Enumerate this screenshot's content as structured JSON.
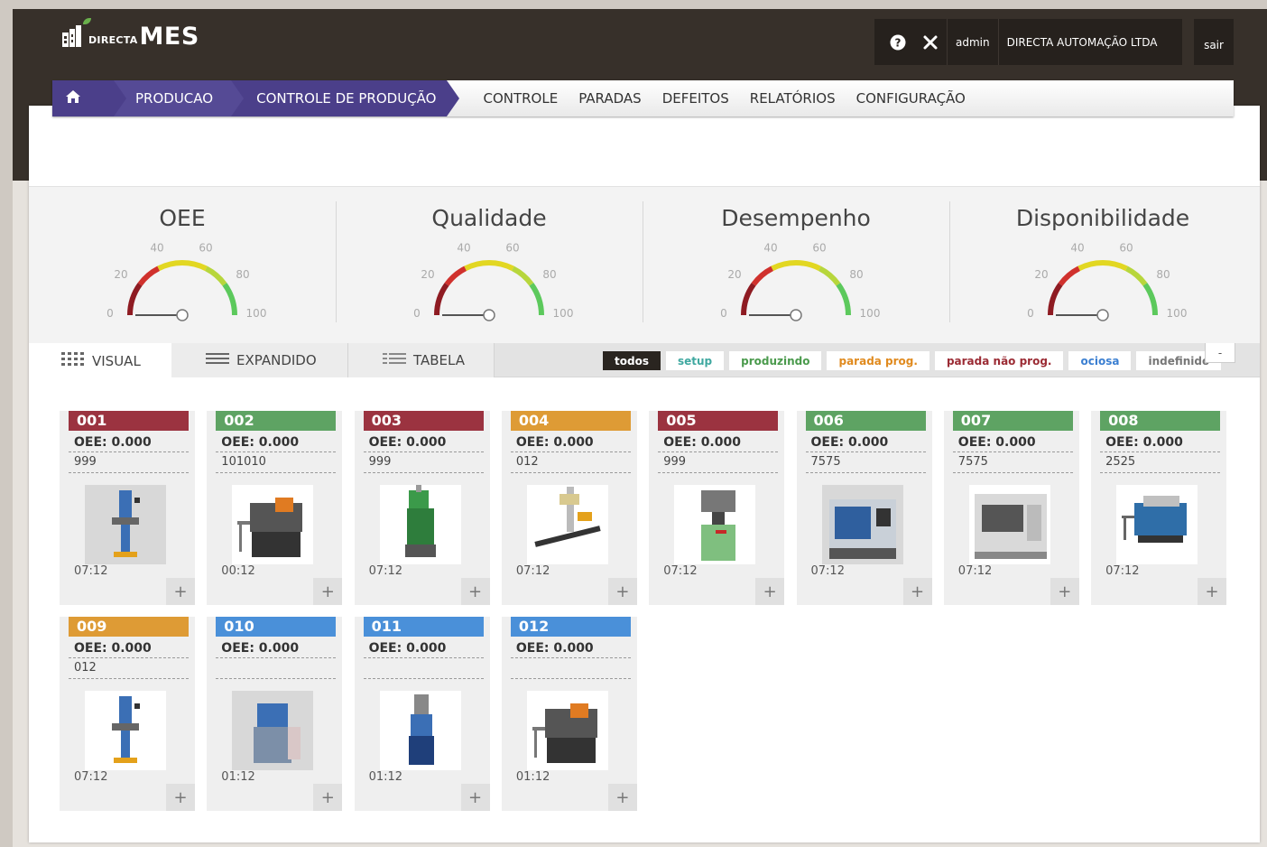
{
  "app": {
    "logo_small": "DIRECTA",
    "logo_big": "MES",
    "topbar": {
      "user": "admin",
      "company": "DIRECTA AUTOMAÇÃO LTDA",
      "logout": "sair"
    }
  },
  "nav": {
    "breadcrumbs": [
      "PRODUCAO",
      "CONTROLE DE PRODUÇÃO"
    ],
    "menu": [
      "CONTROLE",
      "PARADAS",
      "DEFEITOS",
      "RELATÓRIOS",
      "CONFIGURAÇÃO"
    ]
  },
  "gauges": [
    {
      "title": "OEE",
      "value": 0
    },
    {
      "title": "Qualidade",
      "value": 0
    },
    {
      "title": "Desempenho",
      "value": 0
    },
    {
      "title": "Disponibilidade",
      "value": 0
    }
  ],
  "gauge_ticks": [
    "0",
    "20",
    "40",
    "60",
    "80",
    "100"
  ],
  "views": [
    "VISUAL",
    "EXPANDIDO",
    "TABELA"
  ],
  "filters": [
    {
      "label": "todos",
      "color": "#ffffff",
      "active": true
    },
    {
      "label": "setup",
      "color": "#3fa8a0"
    },
    {
      "label": "produzindo",
      "color": "#4a9a4c"
    },
    {
      "label": "parada prog.",
      "color": "#e08a1e"
    },
    {
      "label": "parada não prog.",
      "color": "#9b2b34"
    },
    {
      "label": "ociosa",
      "color": "#3b7fd1"
    },
    {
      "label": "indefinido",
      "color": "#777777"
    }
  ],
  "collapse_label": "-",
  "status_colors": {
    "parada_nao_prog": "#9b3340",
    "produzindo": "#5ea363",
    "parada_prog": "#de9b35",
    "ociosa": "#4a90d9"
  },
  "machines": [
    {
      "id": "001",
      "oee": "OEE: 0.000",
      "code": "999",
      "time": "07:12",
      "status": "parada_nao_prog",
      "icon": "milling-machine-icon",
      "grey": true
    },
    {
      "id": "002",
      "oee": "OEE: 0.000",
      "code": "101010",
      "time": "00:12",
      "status": "produzindo",
      "icon": "lathe-machine-icon"
    },
    {
      "id": "003",
      "oee": "OEE: 0.000",
      "code": "999",
      "time": "07:12",
      "status": "parada_nao_prog",
      "icon": "injection-machine-icon"
    },
    {
      "id": "004",
      "oee": "OEE: 0.000",
      "code": "012",
      "time": "07:12",
      "status": "parada_prog",
      "icon": "drill-conveyor-icon"
    },
    {
      "id": "005",
      "oee": "OEE: 0.000",
      "code": "999",
      "time": "07:12",
      "status": "parada_nao_prog",
      "icon": "press-machine-icon"
    },
    {
      "id": "006",
      "oee": "OEE: 0.000",
      "code": "7575",
      "time": "07:12",
      "status": "produzindo",
      "icon": "cnc-center-icon",
      "grey": true
    },
    {
      "id": "007",
      "oee": "OEE: 0.000",
      "code": "7575",
      "time": "07:12",
      "status": "produzindo",
      "icon": "cnc-lathe-icon"
    },
    {
      "id": "008",
      "oee": "OEE: 0.000",
      "code": "2525",
      "time": "07:12",
      "status": "produzindo",
      "icon": "band-saw-icon"
    },
    {
      "id": "009",
      "oee": "OEE: 0.000",
      "code": "012",
      "time": "07:12",
      "status": "parada_prog",
      "icon": "milling-machine-icon"
    },
    {
      "id": "010",
      "oee": "OEE: 0.000",
      "code": "",
      "time": "01:12",
      "status": "ociosa",
      "icon": "grinder-machine-icon",
      "grey": true
    },
    {
      "id": "011",
      "oee": "OEE: 0.000",
      "code": "",
      "time": "01:12",
      "status": "ociosa",
      "icon": "drill-press-icon"
    },
    {
      "id": "012",
      "oee": "OEE: 0.000",
      "code": "",
      "time": "01:12",
      "status": "ociosa",
      "icon": "lathe-machine-icon"
    }
  ]
}
